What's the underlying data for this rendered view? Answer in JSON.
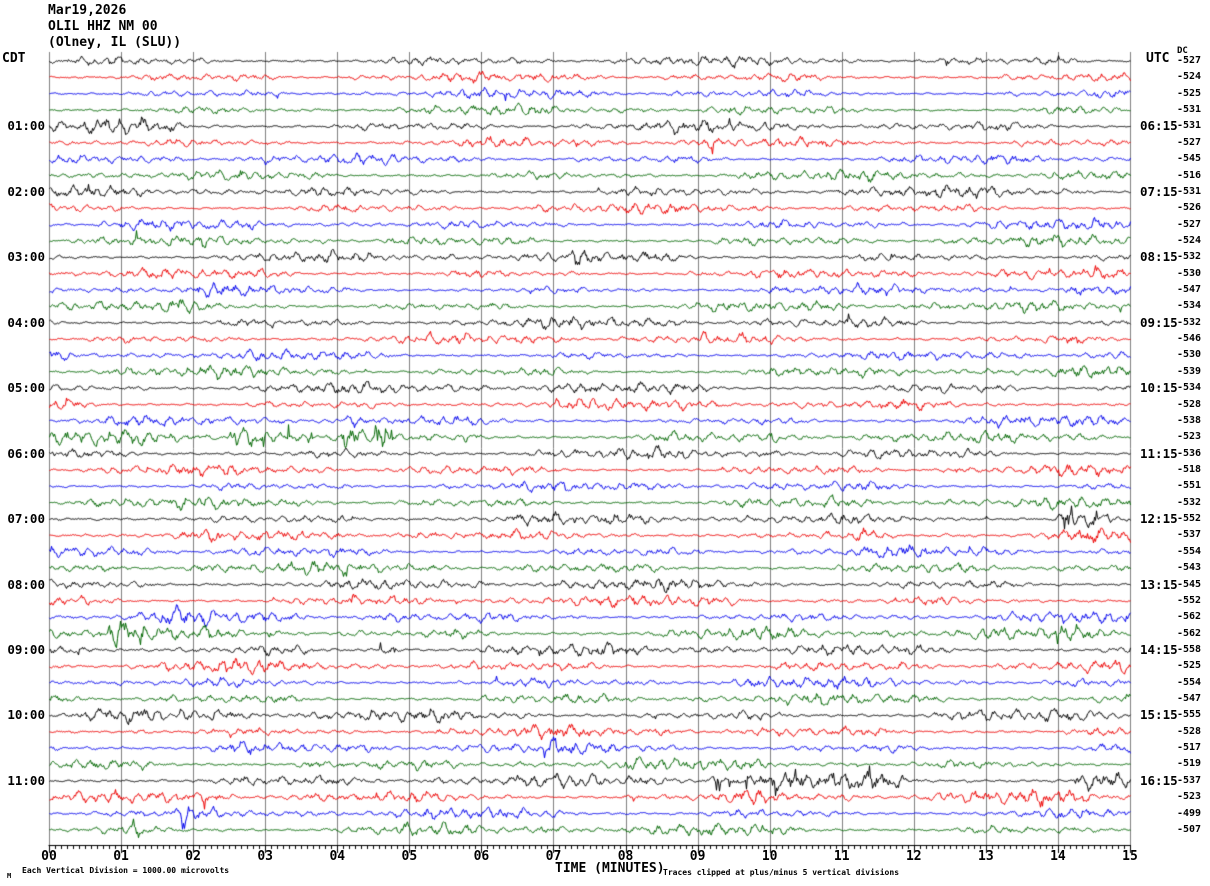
{
  "header": {
    "date": "Mar19,2026",
    "station": "OLIL HHZ NM 00",
    "location": "(Olney, IL (SLU))"
  },
  "footer": {
    "left_note": "Each Vertical Division = 1000.00 microvolts",
    "right_note": "Traces clipped at plus/minus 5 vertical divisions",
    "watermark": "M"
  },
  "chart_data": {
    "type": "line",
    "title": "OLIL HHZ NM 00 helicorder record, Mar19,2026, Olney IL (SLU)",
    "xlabel": "TIME (MINUTES)",
    "x_range_minutes": [
      0,
      15
    ],
    "minutes_per_line": 15,
    "grid": true,
    "left_axis_label": "CDT",
    "right_axis_label": "UTC",
    "dc_column_label": "DC",
    "x_tick_labels": [
      "00",
      "01",
      "02",
      "03",
      "04",
      "05",
      "06",
      "07",
      "08",
      "09",
      "10",
      "11",
      "12",
      "13",
      "14",
      "15"
    ],
    "hour_labels": [
      {
        "row": 4,
        "cdt": "01:00",
        "utc": "06:15"
      },
      {
        "row": 8,
        "cdt": "02:00",
        "utc": "07:15"
      },
      {
        "row": 12,
        "cdt": "03:00",
        "utc": "08:15"
      },
      {
        "row": 16,
        "cdt": "04:00",
        "utc": "09:15"
      },
      {
        "row": 20,
        "cdt": "05:00",
        "utc": "10:15"
      },
      {
        "row": 24,
        "cdt": "06:00",
        "utc": "11:15"
      },
      {
        "row": 28,
        "cdt": "07:00",
        "utc": "12:15"
      },
      {
        "row": 32,
        "cdt": "08:00",
        "utc": "13:15"
      },
      {
        "row": 36,
        "cdt": "09:00",
        "utc": "14:15"
      },
      {
        "row": 40,
        "cdt": "10:00",
        "utc": "15:15"
      },
      {
        "row": 44,
        "cdt": "11:00",
        "utc": "16:15"
      }
    ],
    "trace_colors": {
      "black": "#000000",
      "red": "#ee0000",
      "blue": "#0000ee",
      "green": "#006600"
    },
    "grid_color": "#808080",
    "axis_color": "#000000",
    "rows": [
      {
        "c": "black",
        "dc": -527,
        "base": 0.9
      },
      {
        "c": "red",
        "dc": -524,
        "base": 0.9
      },
      {
        "c": "blue",
        "dc": -525,
        "base": 0.85
      },
      {
        "c": "green",
        "dc": -531,
        "base": 0.9
      },
      {
        "c": "black",
        "dc": -531,
        "base": 1.0,
        "ev": [
          [
            0.4,
            2.6,
            1.9
          ]
        ]
      },
      {
        "c": "red",
        "dc": -527,
        "base": 0.95,
        "ev": [
          [
            0.6,
            1.2,
            1.4
          ]
        ]
      },
      {
        "c": "blue",
        "dc": -545,
        "base": 0.9
      },
      {
        "c": "green",
        "dc": -516,
        "base": 0.95
      },
      {
        "c": "black",
        "dc": -531,
        "base": 1.0
      },
      {
        "c": "red",
        "dc": -526,
        "base": 0.95
      },
      {
        "c": "blue",
        "dc": -527,
        "base": 0.9
      },
      {
        "c": "green",
        "dc": -524,
        "base": 0.95
      },
      {
        "c": "black",
        "dc": -532,
        "base": 1.0,
        "ev": [
          [
            7.25,
            7.6,
            1.9
          ]
        ]
      },
      {
        "c": "red",
        "dc": -530,
        "base": 0.95
      },
      {
        "c": "blue",
        "dc": -547,
        "base": 0.9,
        "ev": [
          [
            2.0,
            2.5,
            1.7
          ]
        ]
      },
      {
        "c": "green",
        "dc": -534,
        "base": 0.95,
        "ev": [
          [
            1.7,
            2.2,
            1.6
          ]
        ]
      },
      {
        "c": "black",
        "dc": -532,
        "base": 1.0
      },
      {
        "c": "red",
        "dc": -546,
        "base": 0.95,
        "ev": [
          [
            9.0,
            9.25,
            2.2
          ]
        ]
      },
      {
        "c": "blue",
        "dc": -530,
        "base": 0.9
      },
      {
        "c": "green",
        "dc": -539,
        "base": 1.0
      },
      {
        "c": "black",
        "dc": -534,
        "base": 1.05,
        "ev": [
          [
            1.5,
            3.0,
            1.3
          ],
          [
            12.25,
            12.55,
            2.0
          ]
        ]
      },
      {
        "c": "red",
        "dc": -528,
        "base": 1.0
      },
      {
        "c": "blue",
        "dc": -538,
        "base": 0.95,
        "ev": [
          [
            3.1,
            3.45,
            2.0
          ],
          [
            4.1,
            4.35,
            1.8
          ]
        ]
      },
      {
        "c": "green",
        "dc": -523,
        "base": 1.05,
        "ev": [
          [
            0.0,
            2.45,
            1.4
          ],
          [
            2.45,
            3.7,
            5.5
          ],
          [
            4.05,
            4.35,
            3.5
          ],
          [
            4.5,
            4.75,
            6.5
          ],
          [
            5.7,
            6.15,
            2.2
          ],
          [
            10.0,
            10.3,
            1.8
          ],
          [
            14.2,
            14.5,
            1.7
          ]
        ]
      },
      {
        "c": "black",
        "dc": -536,
        "base": 1.0,
        "ev": [
          [
            2.5,
            3.3,
            1.4
          ]
        ]
      },
      {
        "c": "red",
        "dc": -518,
        "base": 0.95
      },
      {
        "c": "blue",
        "dc": -551,
        "base": 0.95
      },
      {
        "c": "green",
        "dc": -532,
        "base": 1.0
      },
      {
        "c": "black",
        "dc": -552,
        "base": 1.05,
        "ev": [
          [
            3.95,
            4.55,
            2.0
          ],
          [
            13.95,
            14.75,
            4.5
          ]
        ]
      },
      {
        "c": "red",
        "dc": -537,
        "base": 1.0,
        "ev": [
          [
            11.2,
            11.8,
            2.0
          ],
          [
            14.2,
            14.6,
            1.5
          ]
        ]
      },
      {
        "c": "blue",
        "dc": -554,
        "base": 1.0,
        "ev": [
          [
            0.4,
            1.3,
            1.7
          ]
        ]
      },
      {
        "c": "green",
        "dc": -543,
        "base": 1.05,
        "ev": [
          [
            1.8,
            2.35,
            1.8
          ]
        ]
      },
      {
        "c": "black",
        "dc": -545,
        "base": 1.05
      },
      {
        "c": "red",
        "dc": -552,
        "base": 1.0,
        "ev": [
          [
            4.15,
            4.3,
            2.3
          ],
          [
            6.7,
            7.5,
            1.4
          ]
        ]
      },
      {
        "c": "blue",
        "dc": -562,
        "base": 1.0,
        "ev": [
          [
            1.5,
            2.5,
            1.6
          ],
          [
            4.5,
            5.3,
            1.6
          ]
        ]
      },
      {
        "c": "green",
        "dc": -562,
        "base": 1.1,
        "ev": [
          [
            0.8,
            1.35,
            2.6
          ],
          [
            2.0,
            2.65,
            1.8
          ],
          [
            3.0,
            3.65,
            2.6
          ],
          [
            4.0,
            4.35,
            1.8
          ],
          [
            9.2,
            9.9,
            1.6
          ],
          [
            13.9,
            14.6,
            1.8
          ]
        ]
      },
      {
        "c": "black",
        "dc": -558,
        "base": 1.1,
        "ev": [
          [
            0.3,
            3.8,
            1.25
          ],
          [
            4.55,
            4.95,
            3.2
          ]
        ]
      },
      {
        "c": "red",
        "dc": -525,
        "base": 1.05,
        "ev": [
          [
            2.2,
            2.65,
            1.6
          ]
        ]
      },
      {
        "c": "blue",
        "dc": -554,
        "base": 1.0
      },
      {
        "c": "green",
        "dc": -547,
        "base": 1.05
      },
      {
        "c": "black",
        "dc": -555,
        "base": 1.1,
        "ev": [
          [
            0.2,
            3.5,
            1.2
          ],
          [
            4.4,
            4.65,
            1.8
          ]
        ]
      },
      {
        "c": "red",
        "dc": -528,
        "base": 1.05,
        "ev": [
          [
            1.1,
            1.5,
            2.2
          ]
        ]
      },
      {
        "c": "blue",
        "dc": -517,
        "base": 1.0,
        "ev": [
          [
            0.5,
            0.75,
            2.0
          ],
          [
            2.0,
            2.8,
            1.9
          ],
          [
            6.9,
            7.2,
            1.7
          ]
        ]
      },
      {
        "c": "green",
        "dc": -519,
        "base": 1.05,
        "ev": [
          [
            1.1,
            1.65,
            2.0
          ],
          [
            3.35,
            3.85,
            1.9
          ],
          [
            4.5,
            4.65,
            1.8
          ]
        ]
      },
      {
        "c": "black",
        "dc": -537,
        "base": 1.1,
        "ev": [
          [
            9.0,
            11.85,
            3.8
          ],
          [
            14.15,
            15.0,
            2.8
          ]
        ]
      },
      {
        "c": "red",
        "dc": -523,
        "base": 1.05,
        "ev": [
          [
            9.5,
            11.9,
            2.2
          ],
          [
            10.3,
            10.55,
            3.2
          ],
          [
            13.3,
            14.6,
            1.5
          ]
        ]
      },
      {
        "c": "blue",
        "dc": -499,
        "base": 1.0,
        "ev": [
          [
            1.82,
            2.1,
            3.0
          ],
          [
            7.0,
            7.4,
            1.5
          ],
          [
            10.4,
            10.7,
            1.4
          ]
        ]
      },
      {
        "c": "green",
        "dc": -507,
        "base": 1.05,
        "ev": [
          [
            1.15,
            1.35,
            2.4
          ],
          [
            4.8,
            5.05,
            1.9
          ],
          [
            9.0,
            9.5,
            1.4
          ]
        ]
      }
    ]
  }
}
